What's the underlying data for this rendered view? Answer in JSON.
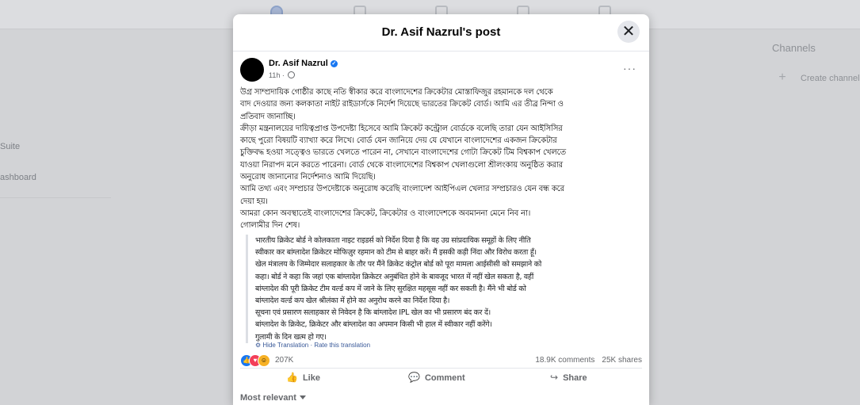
{
  "background": {
    "left_items": [
      "Suite",
      "ashboard"
    ],
    "right_title": "Channels",
    "right_create": "Create channel",
    "plus_glyph": "+"
  },
  "modal": {
    "title": "Dr. Asif Nazrul's post",
    "close_glyph": "✕"
  },
  "post": {
    "author": "Dr. Asif Nazrul",
    "time": "11h",
    "more_glyph": "···",
    "lines": [
      "উগ্র সাম্প্রদায়িক গোষ্ঠীর কাছে নতি স্বীকার করে বাংলাদেশের ক্রিকেটার মোস্তাফিজুর রহমানকে দল থেকে",
      "বাদ দেওয়ার জন্য কলকাতা নাইট রাইডার্সকে নির্দেশ দিয়েছে ভারতের ক্রিকেট বোর্ড। আমি এর তীব্র নিন্দা ও",
      "প্রতিবাদ জানাচ্ছি।",
      "ক্রীড়া মন্ত্রনালয়ের দায়িত্বপ্রাপ্ত উপদেষ্টা হিসেবে আমি ক্রিকেট কন্ট্রোল বোর্ডকে বলেছি তারা যেন আইসিসির",
      "কাছে পুরো বিষয়টি ব্যাখ্যা করে লিখে। বোর্ড যেন জানিয়ে দেয় যে যেখানে বাংলাদেশের একজন ক্রিকেটার",
      "চুক্তিবদ্ধ হওয়া সত্ত্বেও ভারতে খেলতে পারেন না, সেখানে বাংলাদেশের গোটা ক্রিকেট টিম বিশ্বকাপ খেলতে",
      "যাওয়া নিরাপদ মনে করতে পারেনা। বোর্ড  থেকে বাংলাদেশের বিশ্বকাপ খেলাগুলো শ্রীলংকায় অনুষ্ঠিত করার",
      "অনুরোধ জানানোর নির্দেশনাও আমি দিয়েছি।",
      "আমি তথ্য এবং সম্প্রচার উপদেষ্টাকে অনুরোধ করেছি বাংলাদেশ আইপিএল খেলার সম্প্রচারও যেন বন্ধ করে",
      "দেয়া হয়।",
      "আমরা কোন অবস্থাতেই বাংলাদেশের ক্রিকেট, ক্রিকেটার ও বাংলাদেশকে অবমাননা মেনে নিব না।",
      "গোলামীর দিন শেষ।"
    ],
    "translation_lines": [
      "भारतीय क्रिकेट बोर्ड ने कोलकाता नाइट राइडर्स को निर्देश दिया है कि वह उग्र सांप्रदायिक समूहों के लिए नीति",
      "स्वीकार कर बांग्लादेश क्रिकेटर मोफिज़ुर रहमान को टीम से बाहर करें। मैं इसकी कड़ी निंदा और विरोध करता हूँ।",
      "खेल मंत्रालय के जिम्मेदार सलाहकार के तौर पर मैंने क्रिकेट कंट्रोल बोर्ड को पूरा मामला आईसीसी को समझाने को",
      "कहा। बोर्ड ने कहा कि जहां एक बांग्लादेश क्रिकेटर अनुबंधित होने के बावजूद भारत में नहीं खेल सकता है, वहीं",
      "बांग्लादेश की पूरी क्रिकेट टीम वर्ल्ड कप में जाने के लिए सुरक्षित महसूस नहीं कर सकती है। मैंने भी बोर्ड को",
      "बांग्लादेश वर्ल्ड कप खेल श्रीलंका में होने का अनुरोध करने का निर्देश दिया है।",
      "सूचना एवं प्रसारण सलाहकार से निवेदन है कि बांग्लादेश IPL खेल का भी प्रसारण बंद कर दें।",
      "बांग्लादेश के क्रिकेट, क्रिकेटर और बांग्लादेश का अपमान किसी भी हाल में स्वीकार नहीं करेंगे।",
      "गुलामी के दिन खत्म हो गए।"
    ],
    "hide_translation": "Hide Translation",
    "separator": " · ",
    "rate_translation": "Rate this translation"
  },
  "reactions": {
    "count": "207K",
    "comments": "18.9K comments",
    "shares": "25K shares"
  },
  "actions": {
    "like": "Like",
    "comment": "Comment",
    "share": "Share"
  },
  "sort": {
    "label": "Most relevant"
  },
  "colors": {
    "accent": "#1877f2",
    "love": "#f33e58",
    "haha": "#f7b125",
    "link": "#385898"
  },
  "icons": [
    "home-icon",
    "pages-icon",
    "insights-icon",
    "ads-icon",
    "video-icon",
    "verified-badge-icon",
    "globe-icon",
    "like-icon",
    "comment-icon",
    "share-icon",
    "gear-icon",
    "close-icon"
  ]
}
